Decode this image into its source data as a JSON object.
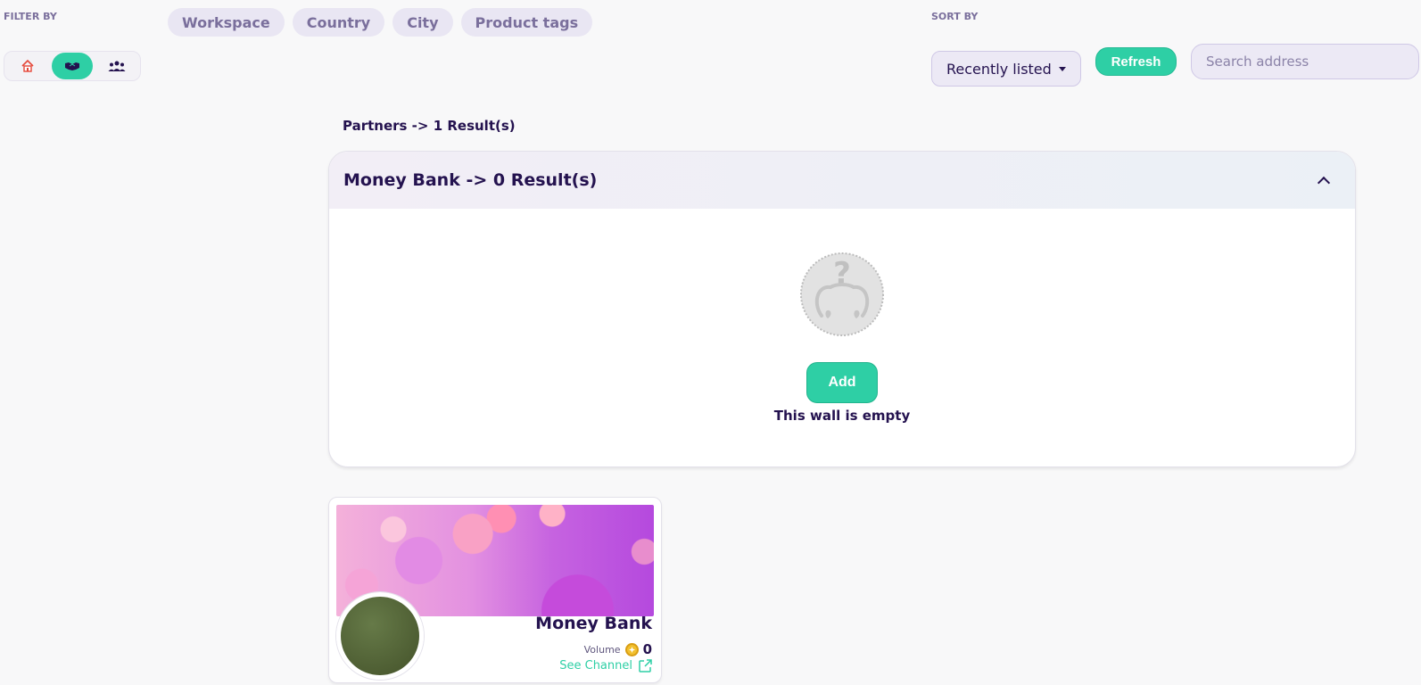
{
  "filter": {
    "label": "FILTER BY",
    "chips": [
      "Workspace",
      "Country",
      "City",
      "Product tags"
    ],
    "view_toggle": {
      "active": "partners",
      "items": [
        {
          "icon": "house-icon",
          "name": "home"
        },
        {
          "icon": "handshake-icon",
          "name": "partners"
        },
        {
          "icon": "users-icon",
          "name": "community"
        }
      ]
    }
  },
  "sort": {
    "label": "SORT BY",
    "selected": "Recently listed"
  },
  "toolbar": {
    "refresh_label": "Refresh",
    "search_placeholder": "Search address"
  },
  "partners": {
    "summary": "Partners -> 1 Result(s)"
  },
  "panel": {
    "title": "Money Bank -> 0 Result(s)",
    "add_label": "Add",
    "empty_text": "This wall is empty"
  },
  "card": {
    "name": "Money Bank",
    "volume_label": "Volume",
    "volume_value": "0",
    "see_channel_label": "See Channel"
  },
  "colors": {
    "accent": "#2ecfa5",
    "text_primary": "#24124f",
    "chip_bg": "#e9e6f3"
  }
}
